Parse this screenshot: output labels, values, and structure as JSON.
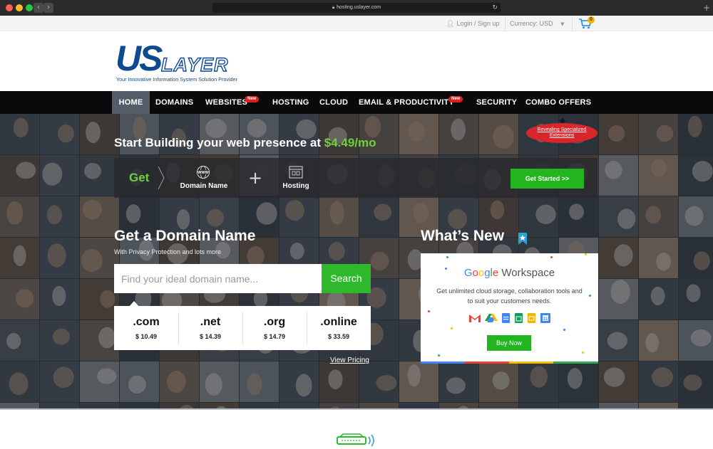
{
  "browser": {
    "url": "hosting.uslayer.com",
    "back_icon": "chevron-left-icon",
    "forward_icon": "chevron-right-icon",
    "lock_icon": "lock-icon",
    "reload_icon": "reload-icon",
    "newtab_icon": "plus-icon"
  },
  "utility": {
    "login_label": "Login / Sign up",
    "currency_label": "Currency:",
    "currency_value": "USD",
    "cart_count": "0"
  },
  "logo": {
    "brand_us": "US",
    "brand_layer": "LAYER",
    "tagline": "Your Innovative Information System Solution Provider"
  },
  "nav": {
    "items": [
      {
        "label": "HOME",
        "active": true
      },
      {
        "label": "DOMAINS"
      },
      {
        "label": "WEBSITES",
        "badge": "New"
      },
      {
        "label": "HOSTING"
      },
      {
        "label": "CLOUD"
      },
      {
        "label": "EMAIL & PRODUCTIVITY",
        "badge": "New"
      },
      {
        "label": "SECURITY"
      },
      {
        "label": "COMBO OFFERS"
      }
    ]
  },
  "promo": {
    "title_prefix": "Start Building your web presence at",
    "price": "$4.49/mo",
    "ribbon": "Revealing Specialized Extensions",
    "get": "Get",
    "item1": "Domain Name",
    "item1_icon": "www-globe-icon",
    "plus": "+",
    "item2": "Hosting",
    "item2_icon": "server-icon",
    "cta": "Get Started >>"
  },
  "domain": {
    "title": "Get a Domain Name",
    "subtitle": "With Privacy Protection and lots more",
    "placeholder": "Find your ideal domain name...",
    "search_button": "Search",
    "tlds": [
      {
        "name": ".com",
        "price": "$ 10.49"
      },
      {
        "name": ".net",
        "price": "$ 14.39"
      },
      {
        "name": ".org",
        "price": "$ 14.79"
      },
      {
        "name": ".online",
        "price": "$ 33.59"
      }
    ],
    "view_pricing": "View Pricing"
  },
  "whats_new": {
    "title": "What’s New",
    "google_letters": [
      "G",
      "o",
      "o",
      "g",
      "l",
      "e"
    ],
    "workspace": "Workspace",
    "description": "Get unlimited cloud storage, collaboration tools and to suit your customers needs.",
    "apps": [
      "gmail-icon",
      "drive-icon",
      "docs-icon",
      "sheets-icon",
      "slides-icon",
      "calendar-icon"
    ],
    "buy_button": "Buy Now"
  },
  "colors": {
    "accent_green": "#22b51f",
    "price_green": "#6fd13a",
    "nav_bg": "#0a0a0a",
    "badge_red": "#e11d1d",
    "logo_blue": "#0d4a8f"
  }
}
